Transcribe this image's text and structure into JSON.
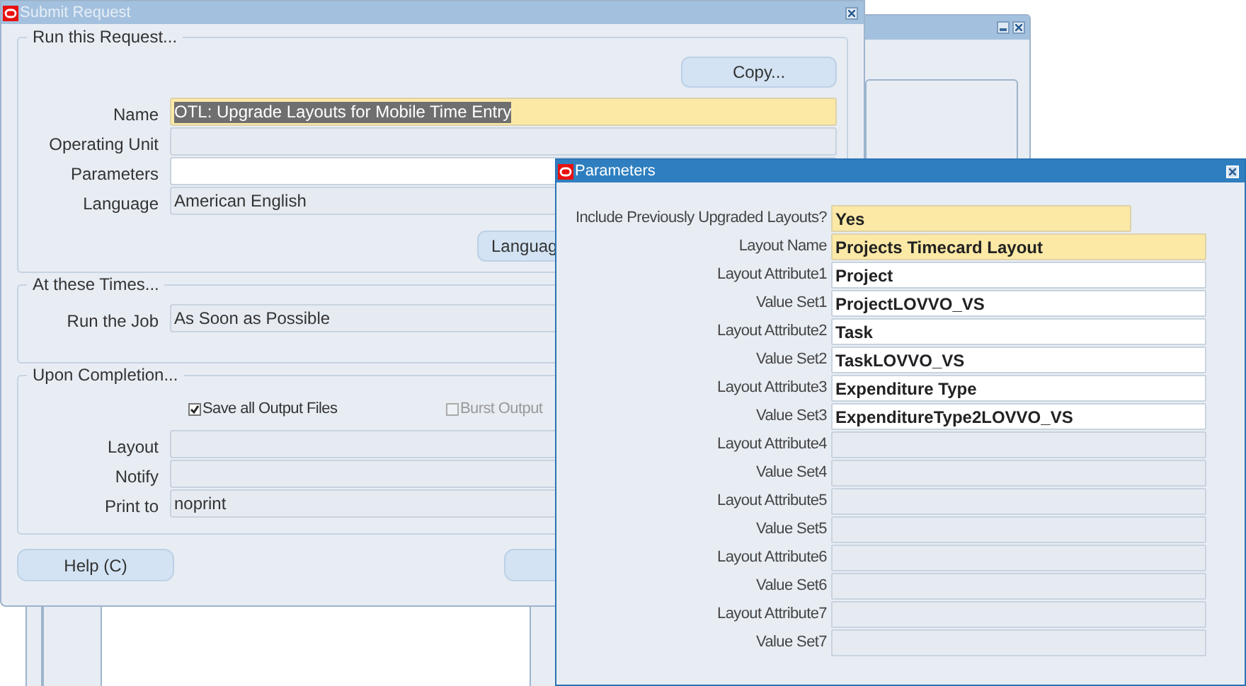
{
  "submit_request": {
    "title": "Submit Request",
    "active": false,
    "sections": [
      {
        "title": "Run this Request...",
        "copy_button": "Copy...",
        "fields": [
          {
            "label": "Name",
            "value": "OTL: Upgrade Layouts for Mobile Time Entry",
            "required": true,
            "highlighted": true,
            "enabled": true
          },
          {
            "label": "Operating Unit",
            "required": false,
            "enabled": false
          },
          {
            "label": "Parameters",
            "required": false,
            "enabled": true
          },
          {
            "label": "Language",
            "value": "American English",
            "required": false,
            "enabled": false
          }
        ],
        "language_button": "Languag"
      },
      {
        "title": "At these Times...",
        "fields": [
          {
            "label": "Run the Job",
            "value": "As Soon as Possible",
            "required": false,
            "enabled": false
          }
        ]
      },
      {
        "title": "Upon Completion...",
        "checkboxes": [
          {
            "label": "Save all Output Files",
            "checked": true,
            "disabled": false
          },
          {
            "label": "Burst Output",
            "checked": false,
            "disabled": true
          }
        ],
        "fields": [
          {
            "label": "Layout",
            "required": false,
            "enabled": false
          },
          {
            "label": "Notify",
            "required": false,
            "enabled": false
          },
          {
            "label": "Print to",
            "value": "noprint",
            "required": false,
            "enabled": false
          }
        ]
      }
    ],
    "help_button": "Help (C)"
  },
  "parameters": {
    "title": "Parameters",
    "active": true,
    "fields": [
      {
        "label": "Include Previously Upgraded Layouts?",
        "value": "Yes",
        "required": true,
        "enabled": true,
        "kind": "short"
      },
      {
        "label": "Layout Name",
        "value": "Projects Timecard Layout",
        "required": true,
        "enabled": true,
        "kind": "long"
      },
      {
        "label": "Layout Attribute1",
        "value": "Project",
        "required": false,
        "enabled": true,
        "kind": "long"
      },
      {
        "label": "Value Set1",
        "value": "ProjectLOVVO_VS",
        "required": false,
        "enabled": true,
        "kind": "long"
      },
      {
        "label": "Layout Attribute2",
        "value": "Task",
        "required": false,
        "enabled": true,
        "kind": "long"
      },
      {
        "label": "Value Set2",
        "value": "TaskLOVVO_VS",
        "required": false,
        "enabled": true,
        "kind": "long"
      },
      {
        "label": "Layout Attribute3",
        "value": "Expenditure Type",
        "required": false,
        "enabled": true,
        "kind": "long"
      },
      {
        "label": "Value Set3",
        "value": "ExpenditureType2LOVVO_VS",
        "required": false,
        "enabled": true,
        "kind": "long"
      },
      {
        "label": "Layout Attribute4",
        "required": false,
        "enabled": false,
        "kind": "long"
      },
      {
        "label": "Value Set4",
        "required": false,
        "enabled": false,
        "kind": "long"
      },
      {
        "label": "Layout Attribute5",
        "required": false,
        "enabled": false,
        "kind": "long"
      },
      {
        "label": "Value Set5",
        "required": false,
        "enabled": false,
        "kind": "long"
      },
      {
        "label": "Layout Attribute6",
        "required": false,
        "enabled": false,
        "kind": "long"
      },
      {
        "label": "Value Set6",
        "required": false,
        "enabled": false,
        "kind": "long"
      },
      {
        "label": "Layout Attribute7",
        "required": false,
        "enabled": false,
        "kind": "long"
      },
      {
        "label": "Value Set7",
        "required": false,
        "enabled": false,
        "kind": "long"
      }
    ]
  }
}
